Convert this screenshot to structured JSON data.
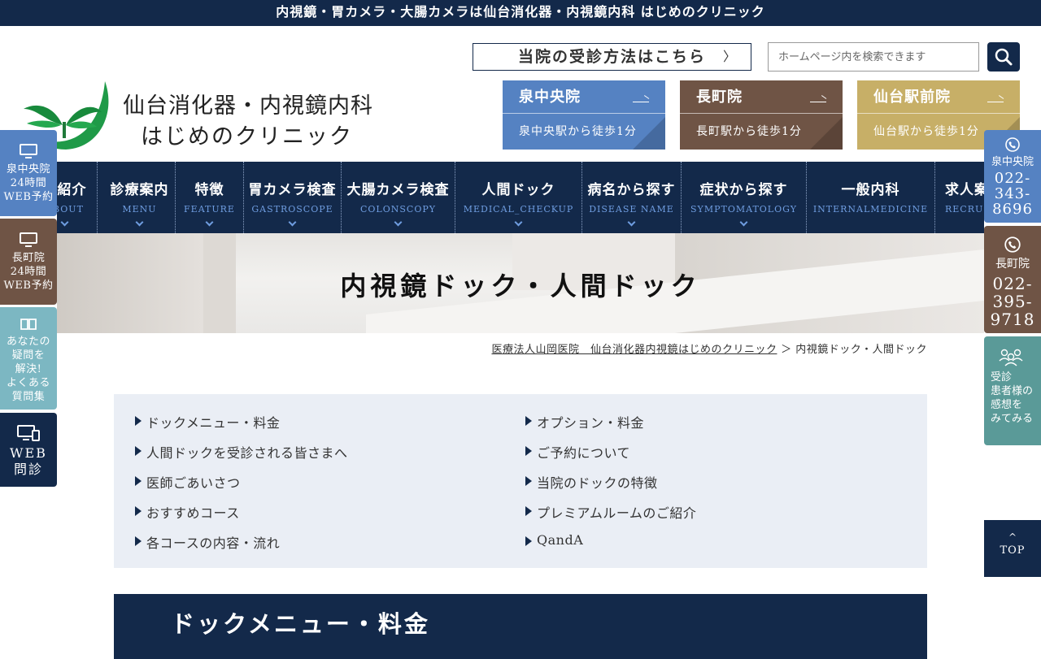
{
  "top_bar": {
    "text": "内視鏡・胃カメラ・大腸カメラは仙台消化器・内視鏡内科 はじめのクリニック"
  },
  "logo": {
    "line1": "仙台消化器・内視鏡内科",
    "line2": "はじめのクリニック"
  },
  "header": {
    "howto_label": "当院の受診方法はこちら",
    "search_placeholder": "ホームページ内を検索できます"
  },
  "branches": [
    {
      "name": "泉中央院",
      "access": "泉中央駅から徒歩1分",
      "color": "#5582c2"
    },
    {
      "name": "長町院",
      "access": "長町駅から徒歩1分",
      "color": "#6f5445"
    },
    {
      "name": "仙台駅前院",
      "access": "仙台駅から徒歩1分",
      "color": "#c7af67"
    }
  ],
  "nav": [
    {
      "jp": "院紹介",
      "en": "ABOUT"
    },
    {
      "jp": "診療案内",
      "en": "MENU"
    },
    {
      "jp": "特徴",
      "en": "FEATURE"
    },
    {
      "jp": "胃カメラ検査",
      "en": "GASTROSCOPE"
    },
    {
      "jp": "大腸カメラ検査",
      "en": "COLONSCOPY"
    },
    {
      "jp": "人間ドック",
      "en": "MEDICAL_CHECKUP"
    },
    {
      "jp": "病名から探す",
      "en": "DISEASE NAME"
    },
    {
      "jp": "症状から探す",
      "en": "SYMPTOMATOLOGY"
    },
    {
      "jp": "一般内科",
      "en": "INTERNALMEDICINE"
    },
    {
      "jp": "求人案",
      "en": "RECRU"
    }
  ],
  "hero": {
    "title": "内視鏡ドック・人間ドック"
  },
  "breadcrumb": {
    "home": "医療法人山岡医院　仙台消化器内視鏡はじめのクリニック",
    "separator": "＞",
    "current": "内視鏡ドック・人間ドック"
  },
  "toc": {
    "left": [
      "ドックメニュー・料金",
      "人間ドックを受診される皆さまへ",
      "医師ごあいさつ",
      "おすすめコース",
      "各コースの内容・流れ"
    ],
    "right": [
      "オプション・料金",
      "ご予約について",
      "当院のドックの特徴",
      "プレミアムルームのご紹介",
      "QandA"
    ]
  },
  "section": {
    "title": "ドックメニュー・料金"
  },
  "left_sidebar": {
    "izumi_booking": {
      "l1": "泉中央院",
      "l2": "24時間",
      "l3": "WEB予約"
    },
    "nagamachi_booking": {
      "l1": "長町院",
      "l2": "24時間",
      "l3": "WEB予約"
    },
    "faq": {
      "l1": "あなたの",
      "l2": "疑問を",
      "l3": "解決!",
      "l4": "よくある",
      "l5": "質問集"
    },
    "web_interview": {
      "l1": "WEB",
      "l2": "問診"
    }
  },
  "right_sidebar": {
    "izumi_phone": {
      "name": "泉中央院",
      "p1": "022-",
      "p2": "343-",
      "p3": "8696"
    },
    "nagamachi_phone": {
      "name": "長町院",
      "p1": "022-",
      "p2": "395-",
      "p3": "9718"
    },
    "reviews": {
      "l1": "受診",
      "l2": "患者様の",
      "l3": "感想を",
      "l4": "みてみる"
    }
  },
  "top_button": {
    "label": "TOP"
  }
}
